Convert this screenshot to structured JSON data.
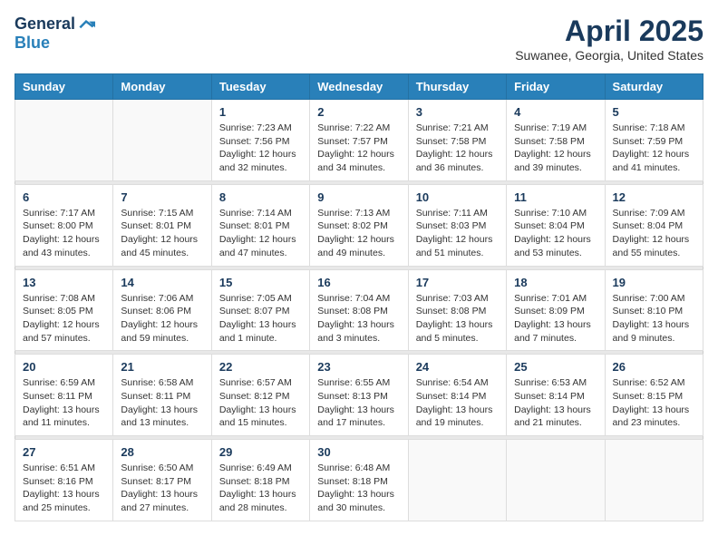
{
  "header": {
    "logo_general": "General",
    "logo_blue": "Blue",
    "month": "April 2025",
    "location": "Suwanee, Georgia, United States"
  },
  "days_of_week": [
    "Sunday",
    "Monday",
    "Tuesday",
    "Wednesday",
    "Thursday",
    "Friday",
    "Saturday"
  ],
  "weeks": [
    [
      {
        "day": "",
        "info": ""
      },
      {
        "day": "",
        "info": ""
      },
      {
        "day": "1",
        "info": "Sunrise: 7:23 AM\nSunset: 7:56 PM\nDaylight: 12 hours and 32 minutes."
      },
      {
        "day": "2",
        "info": "Sunrise: 7:22 AM\nSunset: 7:57 PM\nDaylight: 12 hours and 34 minutes."
      },
      {
        "day": "3",
        "info": "Sunrise: 7:21 AM\nSunset: 7:58 PM\nDaylight: 12 hours and 36 minutes."
      },
      {
        "day": "4",
        "info": "Sunrise: 7:19 AM\nSunset: 7:58 PM\nDaylight: 12 hours and 39 minutes."
      },
      {
        "day": "5",
        "info": "Sunrise: 7:18 AM\nSunset: 7:59 PM\nDaylight: 12 hours and 41 minutes."
      }
    ],
    [
      {
        "day": "6",
        "info": "Sunrise: 7:17 AM\nSunset: 8:00 PM\nDaylight: 12 hours and 43 minutes."
      },
      {
        "day": "7",
        "info": "Sunrise: 7:15 AM\nSunset: 8:01 PM\nDaylight: 12 hours and 45 minutes."
      },
      {
        "day": "8",
        "info": "Sunrise: 7:14 AM\nSunset: 8:01 PM\nDaylight: 12 hours and 47 minutes."
      },
      {
        "day": "9",
        "info": "Sunrise: 7:13 AM\nSunset: 8:02 PM\nDaylight: 12 hours and 49 minutes."
      },
      {
        "day": "10",
        "info": "Sunrise: 7:11 AM\nSunset: 8:03 PM\nDaylight: 12 hours and 51 minutes."
      },
      {
        "day": "11",
        "info": "Sunrise: 7:10 AM\nSunset: 8:04 PM\nDaylight: 12 hours and 53 minutes."
      },
      {
        "day": "12",
        "info": "Sunrise: 7:09 AM\nSunset: 8:04 PM\nDaylight: 12 hours and 55 minutes."
      }
    ],
    [
      {
        "day": "13",
        "info": "Sunrise: 7:08 AM\nSunset: 8:05 PM\nDaylight: 12 hours and 57 minutes."
      },
      {
        "day": "14",
        "info": "Sunrise: 7:06 AM\nSunset: 8:06 PM\nDaylight: 12 hours and 59 minutes."
      },
      {
        "day": "15",
        "info": "Sunrise: 7:05 AM\nSunset: 8:07 PM\nDaylight: 13 hours and 1 minute."
      },
      {
        "day": "16",
        "info": "Sunrise: 7:04 AM\nSunset: 8:08 PM\nDaylight: 13 hours and 3 minutes."
      },
      {
        "day": "17",
        "info": "Sunrise: 7:03 AM\nSunset: 8:08 PM\nDaylight: 13 hours and 5 minutes."
      },
      {
        "day": "18",
        "info": "Sunrise: 7:01 AM\nSunset: 8:09 PM\nDaylight: 13 hours and 7 minutes."
      },
      {
        "day": "19",
        "info": "Sunrise: 7:00 AM\nSunset: 8:10 PM\nDaylight: 13 hours and 9 minutes."
      }
    ],
    [
      {
        "day": "20",
        "info": "Sunrise: 6:59 AM\nSunset: 8:11 PM\nDaylight: 13 hours and 11 minutes."
      },
      {
        "day": "21",
        "info": "Sunrise: 6:58 AM\nSunset: 8:11 PM\nDaylight: 13 hours and 13 minutes."
      },
      {
        "day": "22",
        "info": "Sunrise: 6:57 AM\nSunset: 8:12 PM\nDaylight: 13 hours and 15 minutes."
      },
      {
        "day": "23",
        "info": "Sunrise: 6:55 AM\nSunset: 8:13 PM\nDaylight: 13 hours and 17 minutes."
      },
      {
        "day": "24",
        "info": "Sunrise: 6:54 AM\nSunset: 8:14 PM\nDaylight: 13 hours and 19 minutes."
      },
      {
        "day": "25",
        "info": "Sunrise: 6:53 AM\nSunset: 8:14 PM\nDaylight: 13 hours and 21 minutes."
      },
      {
        "day": "26",
        "info": "Sunrise: 6:52 AM\nSunset: 8:15 PM\nDaylight: 13 hours and 23 minutes."
      }
    ],
    [
      {
        "day": "27",
        "info": "Sunrise: 6:51 AM\nSunset: 8:16 PM\nDaylight: 13 hours and 25 minutes."
      },
      {
        "day": "28",
        "info": "Sunrise: 6:50 AM\nSunset: 8:17 PM\nDaylight: 13 hours and 27 minutes."
      },
      {
        "day": "29",
        "info": "Sunrise: 6:49 AM\nSunset: 8:18 PM\nDaylight: 13 hours and 28 minutes."
      },
      {
        "day": "30",
        "info": "Sunrise: 6:48 AM\nSunset: 8:18 PM\nDaylight: 13 hours and 30 minutes."
      },
      {
        "day": "",
        "info": ""
      },
      {
        "day": "",
        "info": ""
      },
      {
        "day": "",
        "info": ""
      }
    ]
  ]
}
